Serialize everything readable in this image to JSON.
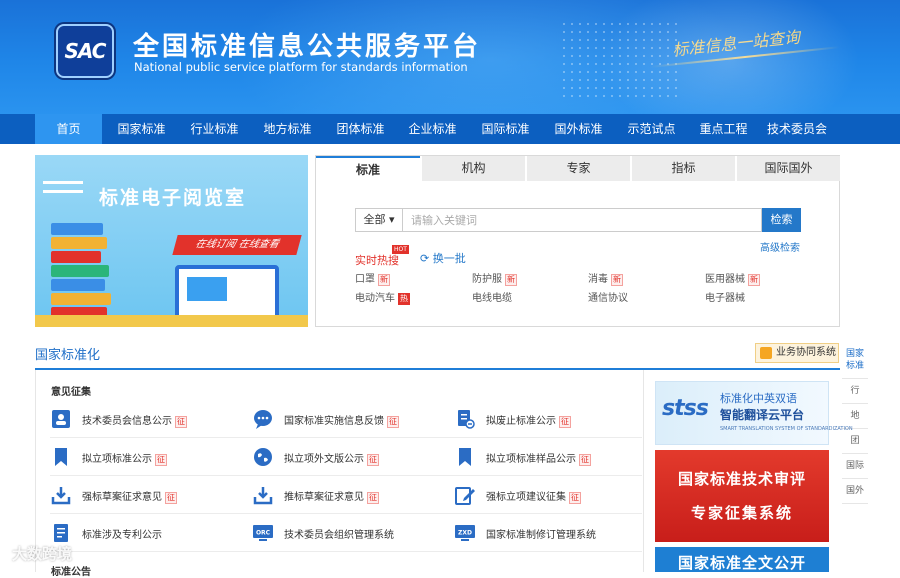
{
  "header": {
    "logo_text": "SAC",
    "title": "全国标准信息公共服务平台",
    "subtitle": "National public service platform  for standards information",
    "slogan": "标准信息一站查询"
  },
  "nav": {
    "items": [
      "首页",
      "国家标准",
      "行业标准",
      "地方标准",
      "团体标准",
      "企业标准",
      "国际标准",
      "国外标准",
      "示范试点",
      "重点工程",
      "技术委员会"
    ],
    "active_index": 0
  },
  "promo": {
    "title": "标准电子阅览室",
    "ribbon": "在线订阅  在线查看"
  },
  "search": {
    "tabs": [
      "标准",
      "机构",
      "专家",
      "指标",
      "国际国外"
    ],
    "active_tab": 0,
    "scope": "全部",
    "placeholder": "请输入关键词",
    "button": "检索",
    "advanced": "高级检索",
    "hot_label": "实时热搜",
    "hot_badge": "HOT",
    "refresh": "换一批",
    "keywords": [
      {
        "text": "口罩",
        "badge": "新"
      },
      {
        "text": "防护服",
        "badge": "新"
      },
      {
        "text": "消毒",
        "badge": "新"
      },
      {
        "text": "医用器械",
        "badge": "新"
      },
      {
        "text": "电动汽车",
        "badge": "热"
      },
      {
        "text": "电线电缆",
        "badge": ""
      },
      {
        "text": "通信协议",
        "badge": ""
      },
      {
        "text": "电子器械",
        "badge": ""
      }
    ]
  },
  "section": {
    "title": "国家标准化",
    "collab": "业务协同系统"
  },
  "side_tabs": [
    "国家标准",
    "行",
    "地",
    "团",
    "国际",
    "国外"
  ],
  "opinion": {
    "heading": "意见征集",
    "tag": "征",
    "items": [
      {
        "label": "技术委员会信息公示",
        "tagged": true,
        "icon": "committee-info-icon"
      },
      {
        "label": "国家标准实施信息反馈",
        "tagged": true,
        "icon": "feedback-chat-icon"
      },
      {
        "label": "拟废止标准公示",
        "tagged": true,
        "icon": "abolish-document-icon"
      },
      {
        "label": "拟立项标准公示",
        "tagged": true,
        "icon": "bookmark-icon"
      },
      {
        "label": "拟立项外文版公示",
        "tagged": true,
        "icon": "globe-icon"
      },
      {
        "label": "拟立项标准样品公示",
        "tagged": true,
        "icon": "bookmark-icon"
      },
      {
        "label": "强标草案征求意见",
        "tagged": true,
        "icon": "download-tray-icon"
      },
      {
        "label": "推标草案征求意见",
        "tagged": true,
        "icon": "download-tray-icon"
      },
      {
        "label": "强标立项建议征集",
        "tagged": true,
        "icon": "edit-icon"
      },
      {
        "label": "标准涉及专利公示",
        "tagged": false,
        "icon": "patent-document-icon"
      },
      {
        "label": "技术委员会组织管理系统",
        "tagged": false,
        "icon": "orc-monitor-icon"
      },
      {
        "label": "国家标准制修订管理系统",
        "tagged": false,
        "icon": "zxd-monitor-icon"
      }
    ],
    "heading2": "标准公告"
  },
  "ads": {
    "stss_logo": "stss",
    "stss_line1": "标准化中英双语",
    "stss_line2": "智能翻译云平台",
    "stss_line3": "SMART TRANSLATION SYSTEM OF STANDARDIZATION",
    "review_line1": "国家标准技术审评",
    "review_line2": "专家征集系统",
    "fulltext": "国家标准全文公开"
  },
  "watermark": "大数跨境",
  "colors": {
    "brand_blue": "#1f7ed8",
    "nav_blue": "#0c5fc0",
    "accent_red": "#e2322b"
  }
}
